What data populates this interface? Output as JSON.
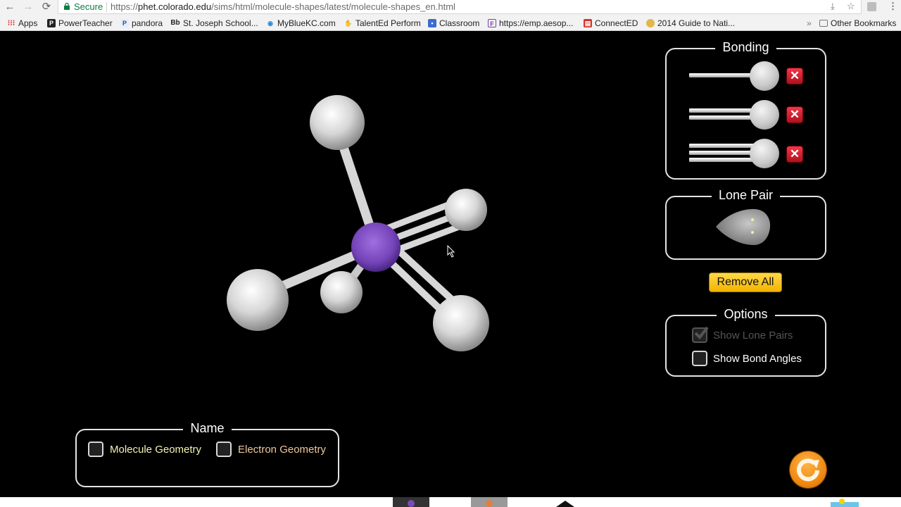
{
  "browser": {
    "nav": {
      "back_icon": "←",
      "forward_icon": "→",
      "reload_icon": "⟳"
    },
    "security_label": "Secure",
    "url_scheme": "https://",
    "url_host": "phet.colorado.edu",
    "url_path": "/sims/html/molecule-shapes/latest/molecule-shapes_en.html",
    "bookmarks": [
      {
        "label": "Apps",
        "icon": "apps-grid-icon"
      },
      {
        "label": "PowerTeacher",
        "icon": "powerteacher-icon"
      },
      {
        "label": "pandora",
        "icon": "pandora-icon"
      },
      {
        "label": "St. Joseph School...",
        "icon": "blackboard-icon"
      },
      {
        "label": "MyBlueKC.com",
        "icon": "bluekc-icon"
      },
      {
        "label": "TalentEd Perform",
        "icon": "talented-icon"
      },
      {
        "label": "Classroom",
        "icon": "classroom-icon"
      },
      {
        "label": "https://emp.aesop...",
        "icon": "aesop-icon"
      },
      {
        "label": "ConnectED",
        "icon": "connected-icon"
      },
      {
        "label": "2014 Guide to Nati...",
        "icon": "guide-icon"
      }
    ],
    "bookmarks_overflow": "»",
    "other_bookmarks": "Other Bookmarks"
  },
  "sim": {
    "molecule": {
      "central_atom_color": "#7a4bb8",
      "outer_atom_color": "#e6e6e6",
      "bonds": [
        {
          "order": 1,
          "direction": "up"
        },
        {
          "order": 3,
          "direction": "right"
        },
        {
          "order": 2,
          "direction": "lower-right"
        },
        {
          "order": 1,
          "direction": "left"
        },
        {
          "order": 1,
          "direction": "back"
        }
      ]
    },
    "bonding_panel": {
      "title": "Bonding",
      "rows": [
        {
          "label": "single-bond",
          "order": 1
        },
        {
          "label": "double-bond",
          "order": 2
        },
        {
          "label": "triple-bond",
          "order": 3
        }
      ],
      "remove_glyph": "✕"
    },
    "lone_pair_panel": {
      "title": "Lone Pair"
    },
    "remove_all_label": "Remove All",
    "options_panel": {
      "title": "Options",
      "show_lone_pairs": {
        "label": "Show Lone Pairs",
        "checked": true,
        "enabled": false
      },
      "show_bond_angles": {
        "label": "Show Bond Angles",
        "checked": false,
        "enabled": true
      }
    },
    "name_panel": {
      "title": "Name",
      "molecule_geometry": {
        "label": "Molecule Geometry",
        "checked": false,
        "color": "#f3f4b0"
      },
      "electron_geometry": {
        "label": "Electron Geometry",
        "checked": false,
        "color": "#f0c89a"
      }
    },
    "reset_icon": "reset-all-icon"
  }
}
